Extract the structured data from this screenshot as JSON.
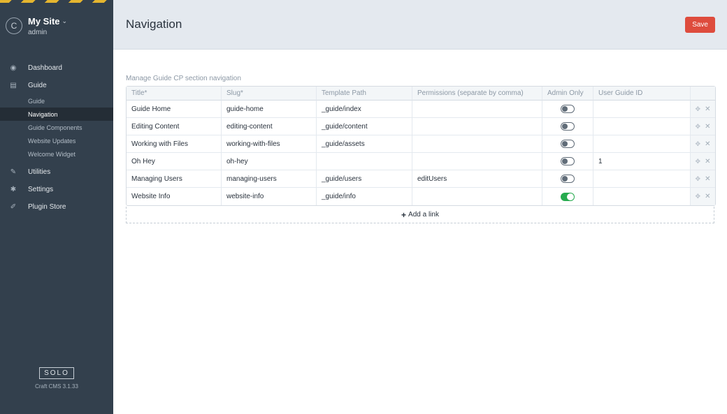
{
  "site": {
    "initial": "C",
    "name": "My Site",
    "user": "admin",
    "chevron": "⌄"
  },
  "sidebar": {
    "items": [
      {
        "label": "Dashboard",
        "icon": "dashboard-icon",
        "glyph": "◉"
      },
      {
        "label": "Guide",
        "icon": "book-icon",
        "glyph": "▤"
      }
    ],
    "sub_items": [
      {
        "label": "Guide"
      },
      {
        "label": "Navigation"
      },
      {
        "label": "Guide Components"
      },
      {
        "label": "Website Updates"
      },
      {
        "label": "Welcome Widget"
      }
    ],
    "bottom_items": [
      {
        "label": "Utilities",
        "icon": "wrench-icon",
        "glyph": "✎"
      },
      {
        "label": "Settings",
        "icon": "gear-icon",
        "glyph": "✱"
      },
      {
        "label": "Plugin Store",
        "icon": "plug-icon",
        "glyph": "✐"
      }
    ],
    "edition": "SOLO",
    "version": "Craft CMS 3.1.33"
  },
  "header": {
    "title": "Navigation",
    "save_label": "Save"
  },
  "field": {
    "label": "Manage Guide CP section navigation"
  },
  "table": {
    "columns": [
      "Title*",
      "Slug*",
      "Template Path",
      "Permissions (separate by comma)",
      "Admin Only",
      "User Guide ID"
    ],
    "rows": [
      {
        "title": "Guide Home",
        "slug": "guide-home",
        "template": "_guide/index",
        "permissions": "",
        "admin_only": false,
        "user_guide_id": ""
      },
      {
        "title": "Editing Content",
        "slug": "editing-content",
        "template": "_guide/content",
        "permissions": "",
        "admin_only": false,
        "user_guide_id": ""
      },
      {
        "title": "Working with Files",
        "slug": "working-with-files",
        "template": "_guide/assets",
        "permissions": "",
        "admin_only": false,
        "user_guide_id": ""
      },
      {
        "title": "Oh Hey",
        "slug": "oh-hey",
        "template": "",
        "permissions": "",
        "admin_only": false,
        "user_guide_id": "1"
      },
      {
        "title": "Managing Users",
        "slug": "managing-users",
        "template": "_guide/users",
        "permissions": "editUsers",
        "admin_only": false,
        "user_guide_id": ""
      },
      {
        "title": "Website Info",
        "slug": "website-info",
        "template": "_guide/info",
        "permissions": "",
        "admin_only": true,
        "user_guide_id": ""
      }
    ],
    "add_label": "Add a link"
  },
  "colors": {
    "sidebar_bg": "#33404d",
    "save": "#de4c3d",
    "toggle_on": "#27ab4f"
  }
}
